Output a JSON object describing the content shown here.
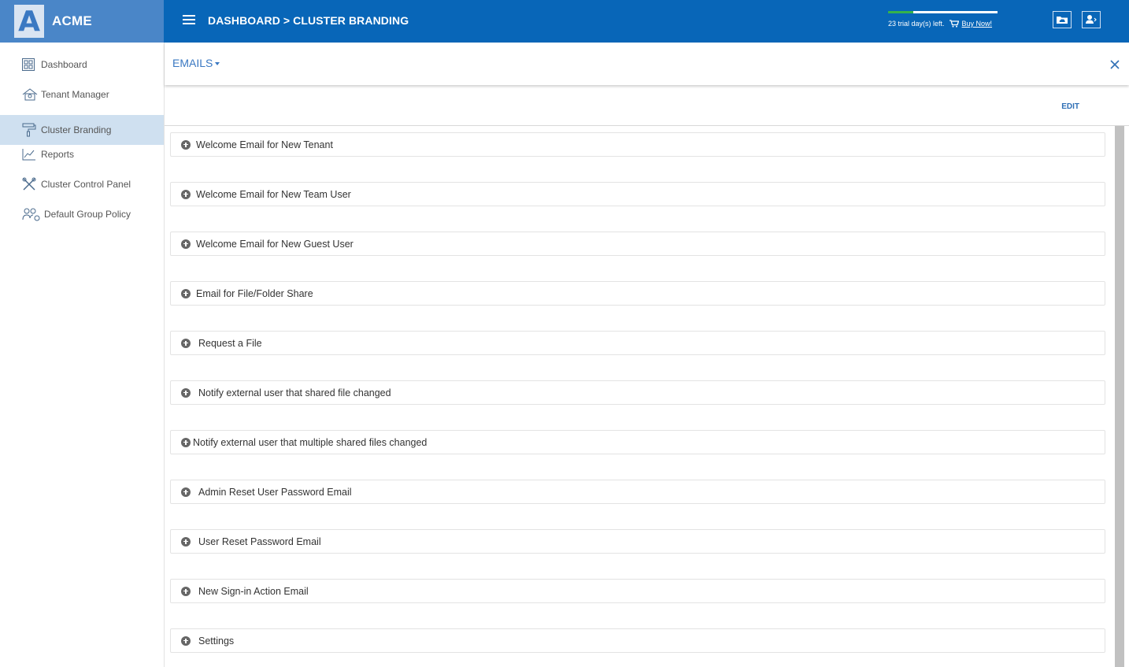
{
  "brand": {
    "logo_letter": "A",
    "name": "ACME"
  },
  "topbar": {
    "breadcrumb": "DASHBOARD > CLUSTER BRANDING",
    "trial_text": "23 trial day(s) left.",
    "buy_label": "Buy Now!",
    "trial_progress_fraction": 0.23,
    "icons": [
      "menu-icon",
      "cloud-folder-icon",
      "user-settings-icon",
      "cart-icon"
    ]
  },
  "sidebar": {
    "items": [
      {
        "label": "Dashboard",
        "icon": "dashboard-icon"
      },
      {
        "label": "Tenant Manager",
        "icon": "tenant-manager-icon"
      },
      {
        "label": "Cluster Branding",
        "icon": "paint-roller-icon",
        "active": true
      },
      {
        "label": "Reports",
        "icon": "reports-chart-icon"
      },
      {
        "label": "Cluster Control Panel",
        "icon": "tools-icon"
      },
      {
        "label": "Default Group Policy",
        "icon": "group-policy-icon"
      }
    ]
  },
  "main": {
    "dropdown_label": "EMAILS",
    "edit_label": "EDIT",
    "items": [
      "Welcome Email for New Tenant",
      "Welcome Email for New Team User",
      "Welcome Email for New Guest User",
      "Email for File/Folder Share",
      "Request a File",
      "Notify external user that shared file changed",
      "Notify external user that multiple shared files changed",
      "Admin Reset User Password Email",
      "User Reset Password Email",
      "New Sign-in Action Email",
      "Settings"
    ]
  },
  "colors": {
    "topbar": "#0866b8",
    "brand": "#4a86c8",
    "active_nav": "#cfe0f0",
    "link": "#3a78c2",
    "trial_progress": "#35b24a"
  }
}
